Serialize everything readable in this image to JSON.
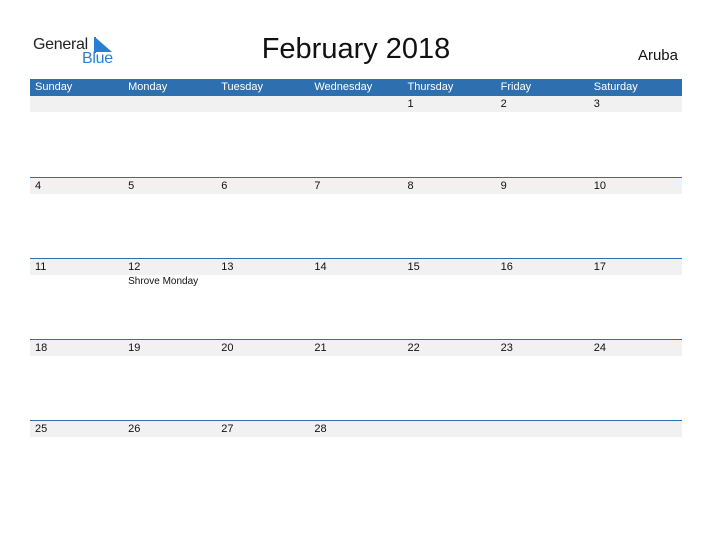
{
  "logo": {
    "general": "General",
    "blue": "Blue"
  },
  "title": "February 2018",
  "country": "Aruba",
  "colors": {
    "header_bg": "#2e6faf",
    "date_row_bg": "#f1f1f1",
    "logo_blue": "#2a7fd4"
  },
  "weekdays": [
    "Sunday",
    "Monday",
    "Tuesday",
    "Wednesday",
    "Thursday",
    "Friday",
    "Saturday"
  ],
  "weeks": [
    {
      "days": [
        "",
        "",
        "",
        "",
        "1",
        "2",
        "3"
      ],
      "events": [
        "",
        "",
        "",
        "",
        "",
        "",
        ""
      ]
    },
    {
      "days": [
        "4",
        "5",
        "6",
        "7",
        "8",
        "9",
        "10"
      ],
      "events": [
        "",
        "",
        "",
        "",
        "",
        "",
        ""
      ]
    },
    {
      "days": [
        "11",
        "12",
        "13",
        "14",
        "15",
        "16",
        "17"
      ],
      "events": [
        "",
        "Shrove Monday",
        "",
        "",
        "",
        "",
        ""
      ]
    },
    {
      "days": [
        "18",
        "19",
        "20",
        "21",
        "22",
        "23",
        "24"
      ],
      "events": [
        "",
        "",
        "",
        "",
        "",
        "",
        ""
      ]
    },
    {
      "days": [
        "25",
        "26",
        "27",
        "28",
        "",
        "",
        ""
      ],
      "events": [
        "",
        "",
        "",
        "",
        "",
        "",
        ""
      ]
    }
  ]
}
